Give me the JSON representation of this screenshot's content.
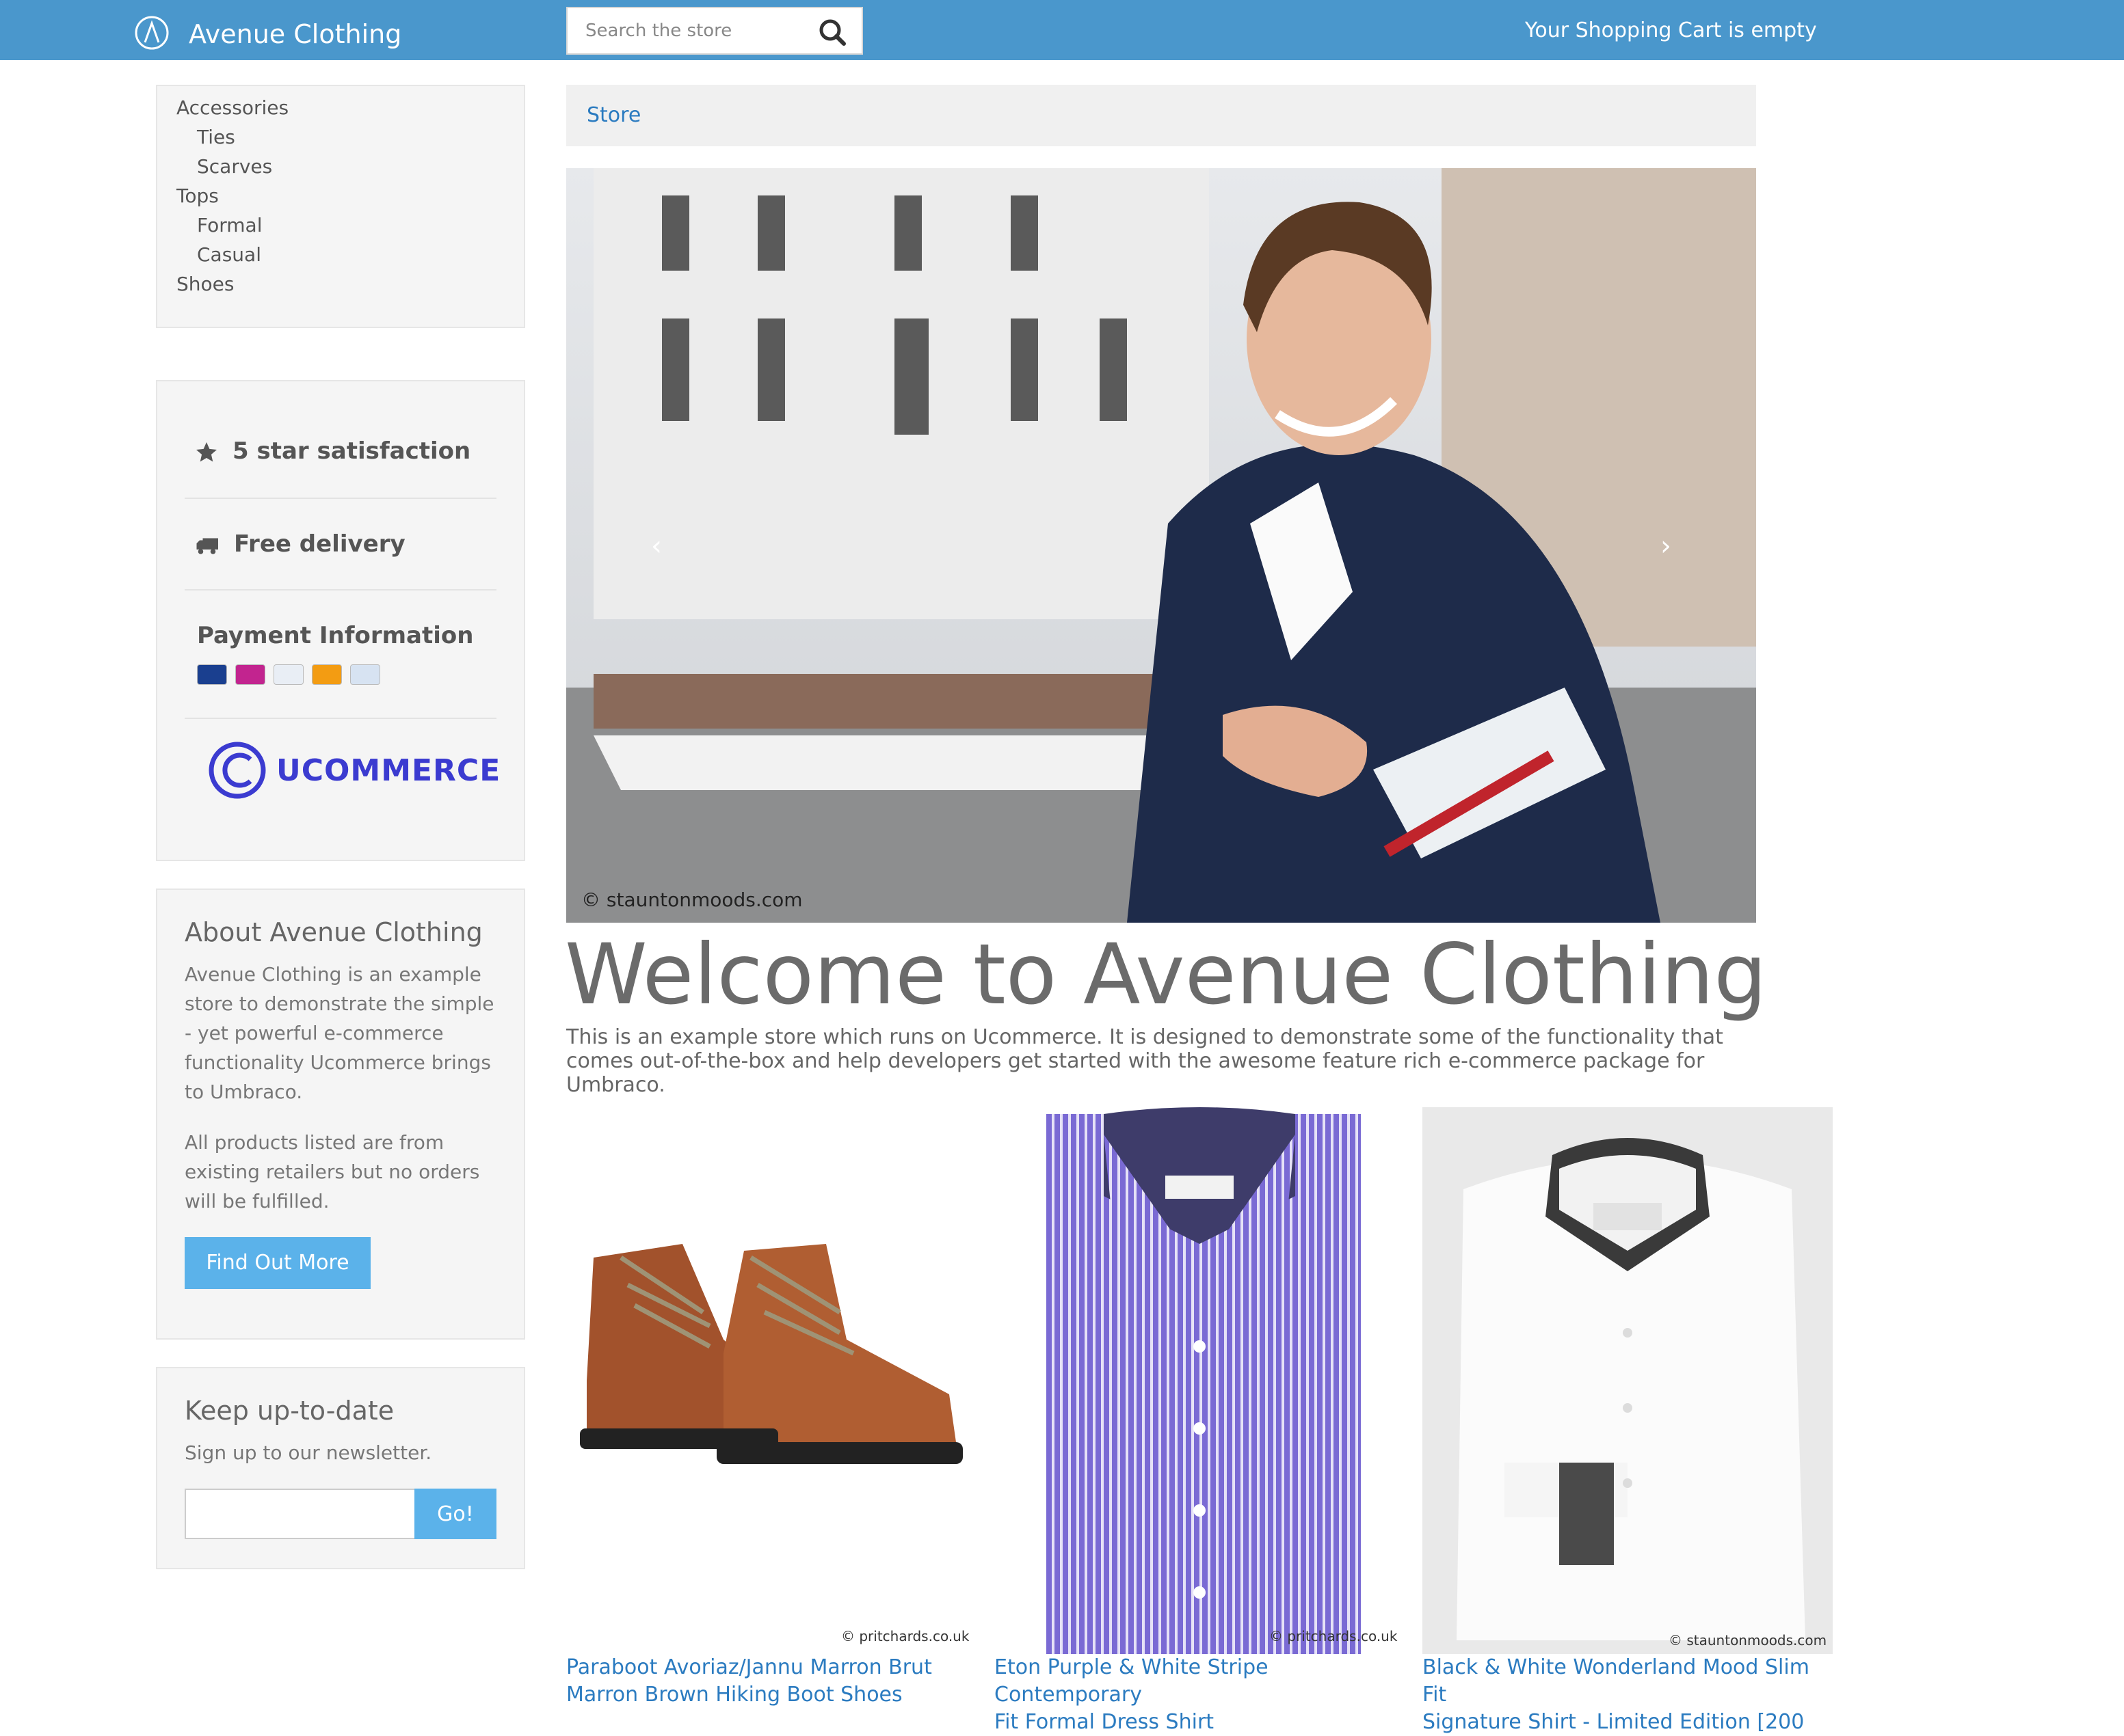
{
  "header": {
    "brand": "Avenue Clothing",
    "search_placeholder": "Search the store",
    "cart_status": "Your Shopping Cart is empty",
    "accent_color": "#4a97cc"
  },
  "sidebar": {
    "categories": [
      {
        "label": "Accessories",
        "level": 0
      },
      {
        "label": "Ties",
        "level": 1
      },
      {
        "label": "Scarves",
        "level": 1
      },
      {
        "label": "Tops",
        "level": 0
      },
      {
        "label": "Formal",
        "level": 1
      },
      {
        "label": "Casual",
        "level": 1
      },
      {
        "label": "Shoes",
        "level": 0
      }
    ],
    "features": {
      "satisfaction": "5 star satisfaction",
      "delivery": "Free delivery",
      "payment_title": "Payment Information",
      "payment_cards": [
        "visa-card-icon",
        "maestro-card-icon",
        "paypal-card-icon",
        "mastercard-card-icon",
        "card-icon"
      ],
      "partner_logo": "UCOMMERCE"
    },
    "about": {
      "title": "About Avenue Clothing",
      "text1": "Avenue Clothing is an example store to demonstrate the simple - yet powerful e-commerce functionality Ucommerce brings to Umbraco.",
      "text2": "All products listed are from existing retailers but no orders will be fulfilled.",
      "button": "Find Out More"
    },
    "newsletter": {
      "title": "Keep up-to-date",
      "text": "Sign up to our newsletter.",
      "button": "Go!"
    }
  },
  "main": {
    "breadcrumb": "Store",
    "hero_credit": "© stauntonmoods.com",
    "welcome_title": "Welcome to Avenue Clothing",
    "intro": "This is an example store which runs on Ucommerce. It is designed to demonstrate some of the functionality that comes out-of-the-box and help developers get started with the awesome feature rich e-commerce package for Umbraco.",
    "products": [
      {
        "title_line1": "Paraboot Avoriaz/Jannu Marron Brut",
        "title_line2": "Marron Brown Hiking Boot Shoes",
        "credit": "© pritchards.co.uk"
      },
      {
        "title_line1": "Eton Purple & White Stripe Contemporary",
        "title_line2": "Fit Formal Dress Shirt",
        "credit": "© pritchards.co.uk"
      },
      {
        "title_line1": "Black & White Wonderland Mood Slim Fit",
        "title_line2": "Signature Shirt - Limited Edition [200",
        "credit": "© stauntonmoods.com"
      }
    ]
  }
}
